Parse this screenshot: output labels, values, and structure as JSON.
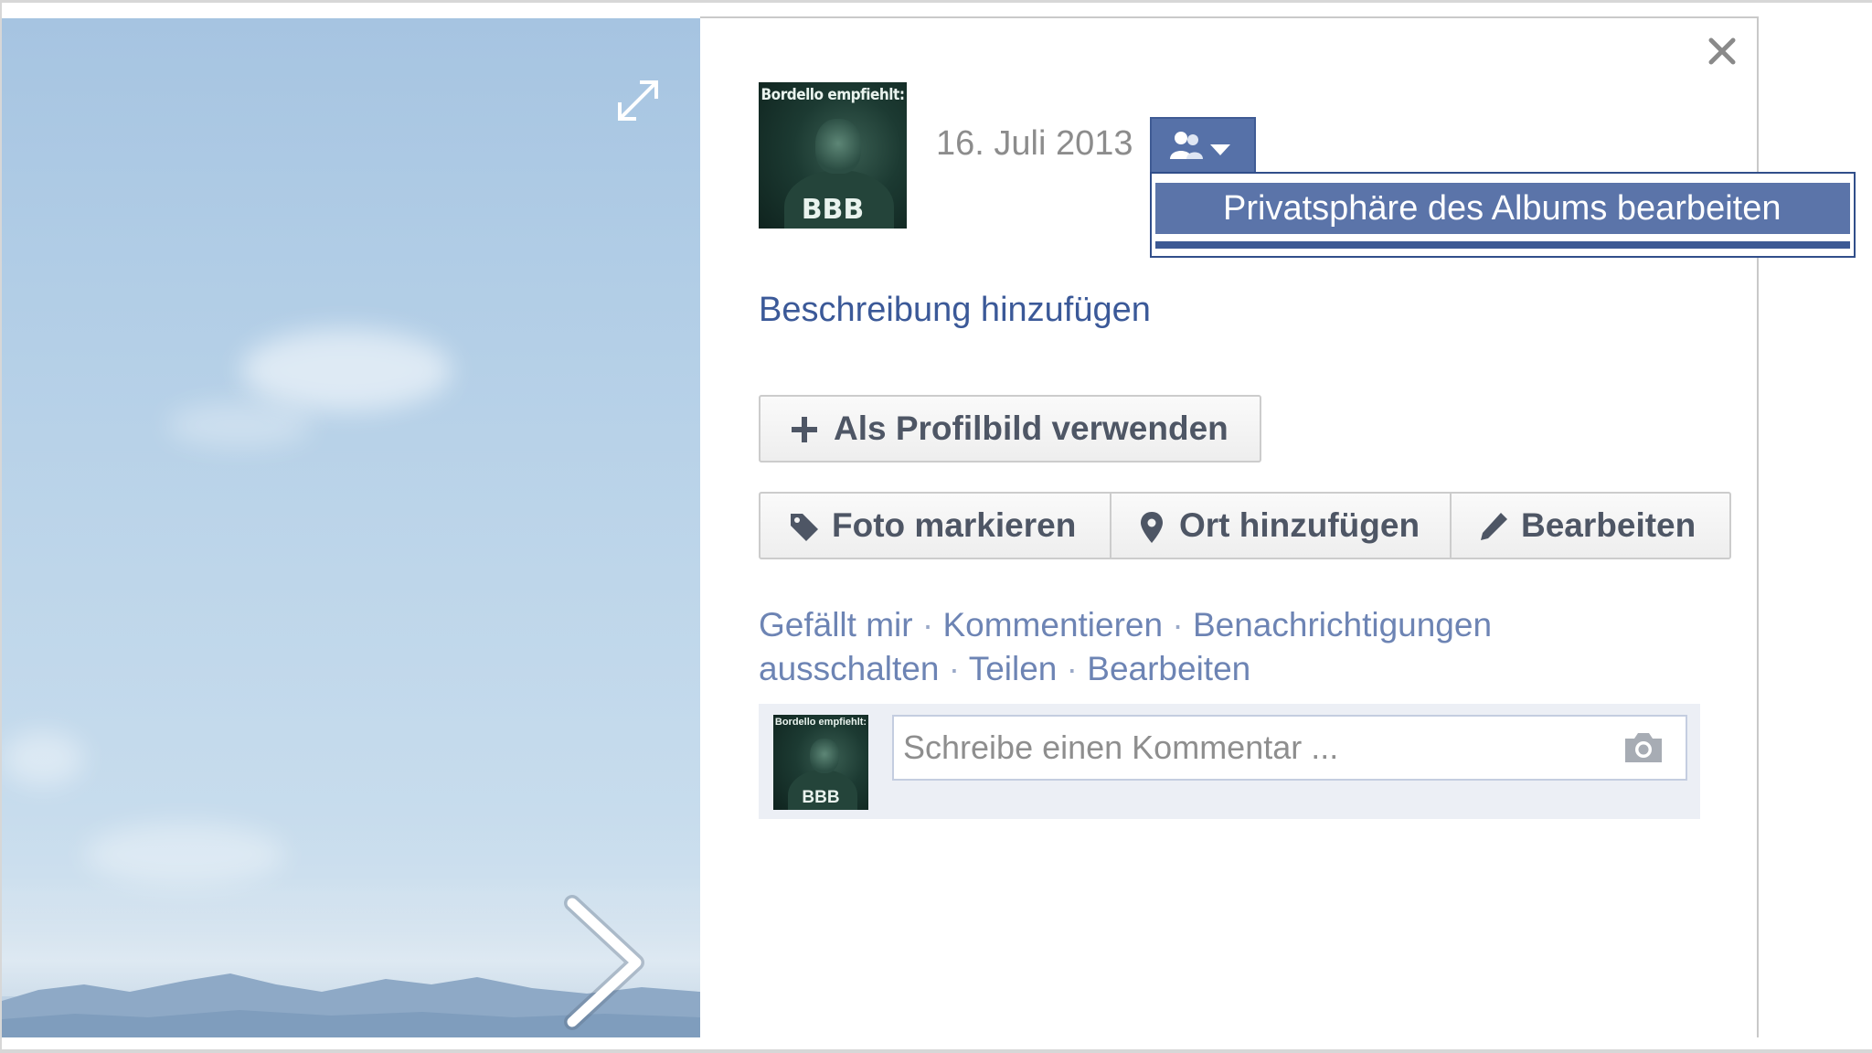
{
  "header": {
    "date": "16. Juli 2013"
  },
  "avatar": {
    "caption": "Bordello empfiehlt:",
    "brand": "BBB"
  },
  "privacy_menu": {
    "item_label": "Privatsphäre des Albums bearbeiten"
  },
  "description": {
    "add_label": "Beschreibung hinzufügen"
  },
  "buttons": {
    "profile_picture": "Als Profilbild verwenden",
    "tag_photo": "Foto markieren",
    "add_place": "Ort hinzufügen",
    "edit": "Bearbeiten"
  },
  "actions": {
    "like": "Gefällt mir",
    "comment": "Kommentieren",
    "notifications_part1": "Benachrichtigungen",
    "notifications_part2": "ausschalten",
    "share": "Teilen",
    "edit": "Bearbeiten",
    "separator": " · "
  },
  "comment": {
    "placeholder": "Schreibe einen Kommentar ..."
  },
  "icons": {
    "close": "close-icon",
    "expand": "expand-icon",
    "next": "chevron-right-icon",
    "privacy": "friends-icon",
    "plus": "plus-icon",
    "tag": "tag-icon",
    "place": "map-pin-icon",
    "pencil": "pencil-icon",
    "camera": "camera-icon"
  },
  "colors": {
    "link": "#3b5998",
    "action_link": "#6d84b4",
    "privacy_button": "#5671a8",
    "dropdown_highlight": "#5b74a9",
    "comment_background": "#eceff5"
  }
}
